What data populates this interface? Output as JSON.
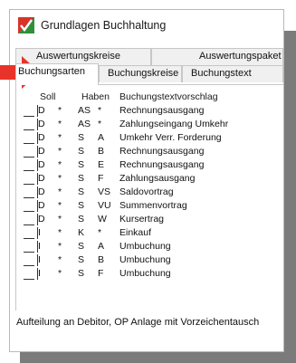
{
  "window": {
    "title": "Grundlagen Buchhaltung"
  },
  "tabs_upper": [
    {
      "label": "Auswertungskreise"
    },
    {
      "label": "Auswertungspaket"
    }
  ],
  "tabs_lower": [
    {
      "label": "Buchungsarten",
      "active": true
    },
    {
      "label": "Buchungskreise",
      "active": false
    },
    {
      "label": "Buchungstext",
      "active": false
    }
  ],
  "grid": {
    "headers": {
      "soll": "Soll",
      "haben": "Haben",
      "text": "Buchungstextvorschlag"
    },
    "rows": [
      {
        "soll": "D",
        "s1": "*",
        "haben": "AS",
        "s2": "*",
        "text": "Rechnungsausgang"
      },
      {
        "soll": "D",
        "s1": "*",
        "haben": "AS",
        "s2": "*",
        "text": "Zahlungseingang Umkehr"
      },
      {
        "soll": "D",
        "s1": "*",
        "haben": "S",
        "s2": "A",
        "text": "Umkehr Verr. Forderung"
      },
      {
        "soll": "D",
        "s1": "*",
        "haben": "S",
        "s2": "B",
        "text": "Rechnungsausgang"
      },
      {
        "soll": "D",
        "s1": "*",
        "haben": "S",
        "s2": "E",
        "text": "Rechnungsausgang"
      },
      {
        "soll": "D",
        "s1": "*",
        "haben": "S",
        "s2": "F",
        "text": "Zahlungsausgang"
      },
      {
        "soll": "D",
        "s1": "*",
        "haben": "S",
        "s2": "VS",
        "text": "Saldovortrag"
      },
      {
        "soll": "D",
        "s1": "*",
        "haben": "S",
        "s2": "VU",
        "text": "Summenvortrag"
      },
      {
        "soll": "D",
        "s1": "*",
        "haben": "S",
        "s2": "W",
        "text": "Kursertrag"
      },
      {
        "soll": "I",
        "s1": "*",
        "haben": "K",
        "s2": "*",
        "text": "Einkauf"
      },
      {
        "soll": "I",
        "s1": "*",
        "haben": "S",
        "s2": "A",
        "text": "Umbuchung"
      },
      {
        "soll": "I",
        "s1": "*",
        "haben": "S",
        "s2": "B",
        "text": "Umbuchung"
      },
      {
        "soll": "I",
        "s1": "*",
        "haben": "S",
        "s2": "F",
        "text": "Umbuchung"
      }
    ]
  },
  "status_text": "Aufteilung an Debitor, OP Anlage mit Vorzeichentausch",
  "colors": {
    "arrow": "#e8332a",
    "shadow": "#7b7b7b",
    "tab_bg": "#f0f0f0",
    "icon_green": "#2f8f3a",
    "icon_red": "#d8322a"
  },
  "icons": {
    "app": "accounting-check-icon",
    "pointer": "red-arrow-icon"
  }
}
